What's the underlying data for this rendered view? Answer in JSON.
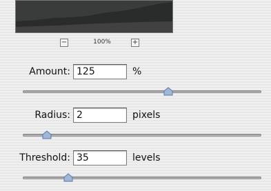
{
  "preview": {
    "zoom_out_icon": "minus-icon",
    "zoom_in_icon": "plus-icon",
    "zoom_level": "100%"
  },
  "controls": {
    "amount": {
      "label": "Amount:",
      "value": "125",
      "unit": "%",
      "slider_fraction": 0.61
    },
    "radius": {
      "label": "Radius:",
      "value": "2",
      "unit": "pixels",
      "slider_fraction": 0.1
    },
    "threshold": {
      "label": "Threshold:",
      "value": "35",
      "unit": "levels",
      "slider_fraction": 0.19
    }
  },
  "colors": {
    "thumb": "#9fb8d9",
    "thumb_border": "#5c79a8"
  }
}
